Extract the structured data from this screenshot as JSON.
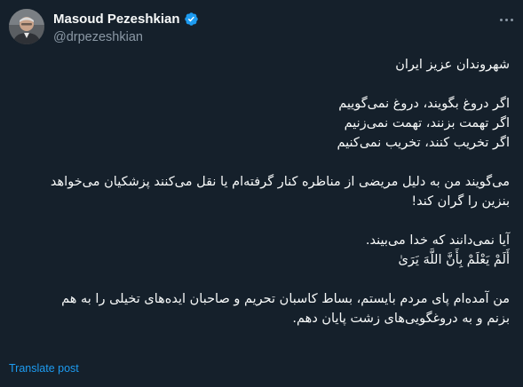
{
  "author": {
    "display_name": "Masoud Pezeshkian",
    "handle": "@drpezeshkian",
    "verified": true,
    "verified_color": "#1d9bf0"
  },
  "tweet": {
    "paragraphs": [
      "شهروندان عزیز ایران",
      "اگر دروغ بگویند، دروغ نمی‌گوییم\nاگر تهمت بزنند، تهمت نمی‌زنیم\nاگر تخریب کنند، تخریب نمی‌کنیم",
      "می‌گویند من به دلیل مریضی از مناظره کنار گرفته‌ام یا نقل می‌کنند پزشکیان می‌خواهد\nبنزین را گران کند!",
      "آیا نمی‌دانند که خدا می‌بیند.\nأَلَمْ يَعْلَمْ بِأَنَّ اللَّهَ يَرَىٰ",
      "من آمده‌ام پای مردم بایستم، بساط کاسبان تحریم و صاحبان ایده‌های تخیلی را به هم\nبزنم و به دروغگویی‌های زشت پایان دهم."
    ]
  },
  "translate_label": "Translate post",
  "icons": {
    "more": "more-horizontal-icon",
    "verified": "verified-badge-icon"
  },
  "colors": {
    "background": "#15202b",
    "text": "#f7f9f9",
    "secondary": "#8b98a5",
    "link": "#1d9bf0"
  }
}
